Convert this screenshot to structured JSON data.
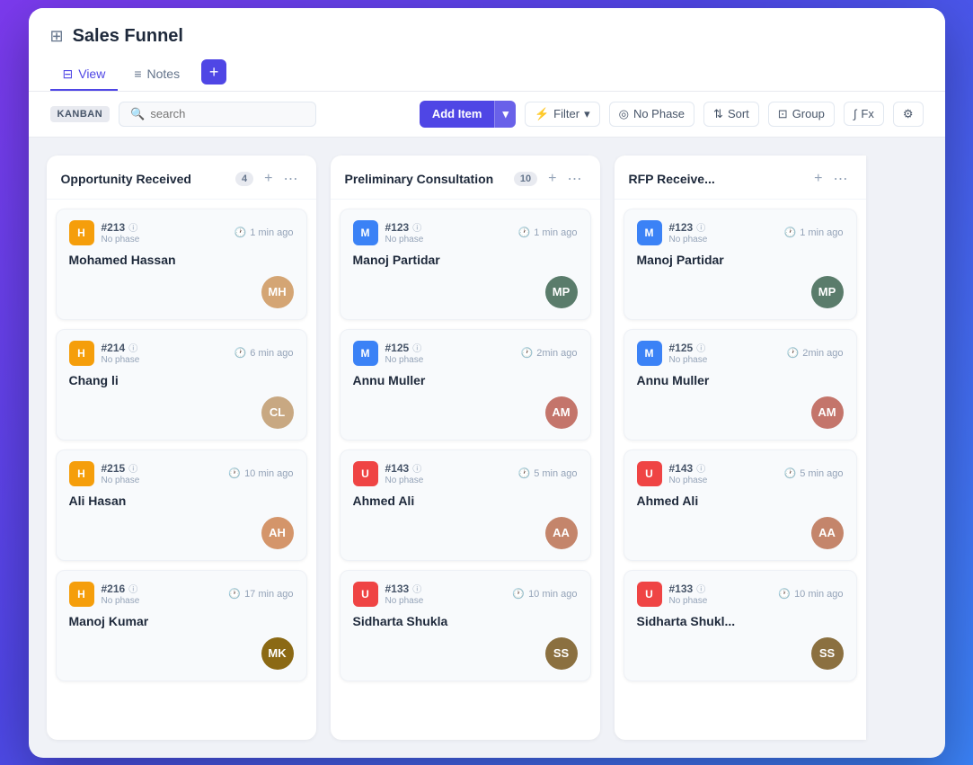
{
  "window": {
    "title": "Sales Funnel",
    "icon": "⊞"
  },
  "tabs": [
    {
      "id": "view",
      "label": "View",
      "icon": "⊟",
      "active": true
    },
    {
      "id": "notes",
      "label": "Notes",
      "icon": "≡",
      "active": false
    }
  ],
  "toolbar": {
    "kanban_label": "KANBAN",
    "search_placeholder": "search",
    "add_item_label": "Add Item",
    "filter_label": "Filter",
    "no_phase_label": "No Phase",
    "sort_label": "Sort",
    "group_label": "Group",
    "fx_label": "Fx"
  },
  "columns": [
    {
      "id": "opportunity-received",
      "title": "Opportunity Received",
      "count": 4,
      "cards": [
        {
          "id": "#213",
          "phase": "No phase",
          "name": "Mohamed Hassan",
          "time": "1 min ago",
          "avatar_color": "#f59e0b",
          "avatar_letter": "H",
          "person_color": "#d4a574"
        },
        {
          "id": "#214",
          "phase": "No phase",
          "name": "Chang li",
          "time": "6 min ago",
          "avatar_color": "#f59e0b",
          "avatar_letter": "H",
          "person_color": "#c8a882"
        },
        {
          "id": "#215",
          "phase": "No phase",
          "name": "Ali Hasan",
          "time": "10 min ago",
          "avatar_color": "#f59e0b",
          "avatar_letter": "H",
          "person_color": "#d4956a"
        },
        {
          "id": "#216",
          "phase": "No phase",
          "name": "Manoj Kumar",
          "time": "17 min ago",
          "avatar_color": "#f59e0b",
          "avatar_letter": "H",
          "person_color": "#8b6914"
        }
      ]
    },
    {
      "id": "preliminary-consultation",
      "title": "Preliminary Consultation",
      "count": 10,
      "cards": [
        {
          "id": "#123",
          "phase": "No phase",
          "name": "Manoj Partidar",
          "time": "1 min ago",
          "avatar_color": "#3b82f6",
          "avatar_letter": "M",
          "person_color": "#5a7c6b"
        },
        {
          "id": "#125",
          "phase": "No phase",
          "name": "Annu Muller",
          "time": "2min ago",
          "avatar_color": "#3b82f6",
          "avatar_letter": "M",
          "person_color": "#c4756b"
        },
        {
          "id": "#143",
          "phase": "No phase",
          "name": "Ahmed Ali",
          "time": "5 min ago",
          "avatar_color": "#ef4444",
          "avatar_letter": "U",
          "person_color": "#c4856b"
        },
        {
          "id": "#133",
          "phase": "No phase",
          "name": "Sidharta Shukla",
          "time": "10 min ago",
          "avatar_color": "#ef4444",
          "avatar_letter": "U",
          "person_color": "#8b7040"
        }
      ]
    },
    {
      "id": "rfp-received",
      "title": "RFP Receive...",
      "count": null,
      "cards": [
        {
          "id": "#123",
          "phase": "No phase",
          "name": "Manoj Partidar",
          "time": "1 min ago",
          "avatar_color": "#3b82f6",
          "avatar_letter": "M",
          "person_color": "#5a7c6b"
        },
        {
          "id": "#125",
          "phase": "No phase",
          "name": "Annu Muller",
          "time": "2min ago",
          "avatar_color": "#3b82f6",
          "avatar_letter": "M",
          "person_color": "#c4756b"
        },
        {
          "id": "#143",
          "phase": "No phase",
          "name": "Ahmed Ali",
          "time": "5 min ago",
          "avatar_color": "#ef4444",
          "avatar_letter": "U",
          "person_color": "#c4856b"
        },
        {
          "id": "#133",
          "phase": "No phase",
          "name": "Sidharta Shukl...",
          "time": "10 min ago",
          "avatar_color": "#ef4444",
          "avatar_letter": "U",
          "person_color": "#8b7040"
        }
      ]
    }
  ]
}
